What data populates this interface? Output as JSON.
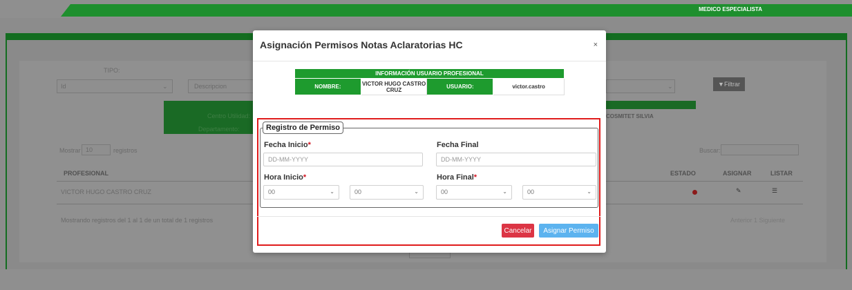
{
  "header": {
    "role": "MEDICO ESPECIALISTA"
  },
  "background": {
    "tipo_label": "TIPO:",
    "tipo_value": "Id",
    "descripcion_placeholder": "Descripcion",
    "filtrar_label": "Filtrar",
    "centro_label": "Centro Utilidad:",
    "departamento_label": "Departamento:",
    "cosmitet_text": "COSMITET SILVIA",
    "mostrar_label": "Mostrar",
    "mostrar_value": "10",
    "registros_label": "registros",
    "buscar_label": "Buscar:",
    "columns": [
      "PROFESIONAL",
      "ESTADO",
      "ASIGNAR",
      "LISTAR"
    ],
    "row_profesional": "VICTOR HUGO CASTRO CRUZ",
    "footer_info": "Mostrando registros del 1 al 1 de un total de 1 registros",
    "pagination": "Anterior 1 Siguiente"
  },
  "modal": {
    "title": "Asignación Permisos Notas Aclaratorias HC",
    "close": "×",
    "info_header": "INFORMACIÓN USUARIO PROFESIONAL",
    "nombre_label": "NOMBRE:",
    "nombre_value": "VICTOR HUGO CASTRO CRUZ",
    "usuario_label": "USUARIO:",
    "usuario_value": "victor.castro",
    "legend": "Registro de Permiso",
    "fecha_inicio_label": "Fecha Inicio",
    "fecha_final_label": "Fecha Final",
    "fecha_placeholder": "DD-MM-YYYY",
    "hora_inicio_label": "Hora Inicio",
    "hora_final_label": "Hora Final",
    "required_mark": "*",
    "select_value": "00",
    "cancel_label": "Cancelar",
    "assign_label": "Asignar Permiso"
  },
  "colors": {
    "green": "#1e9b2e",
    "danger": "#dc3545",
    "primary": "#5cb3ef",
    "outline": "#e01b1b"
  }
}
